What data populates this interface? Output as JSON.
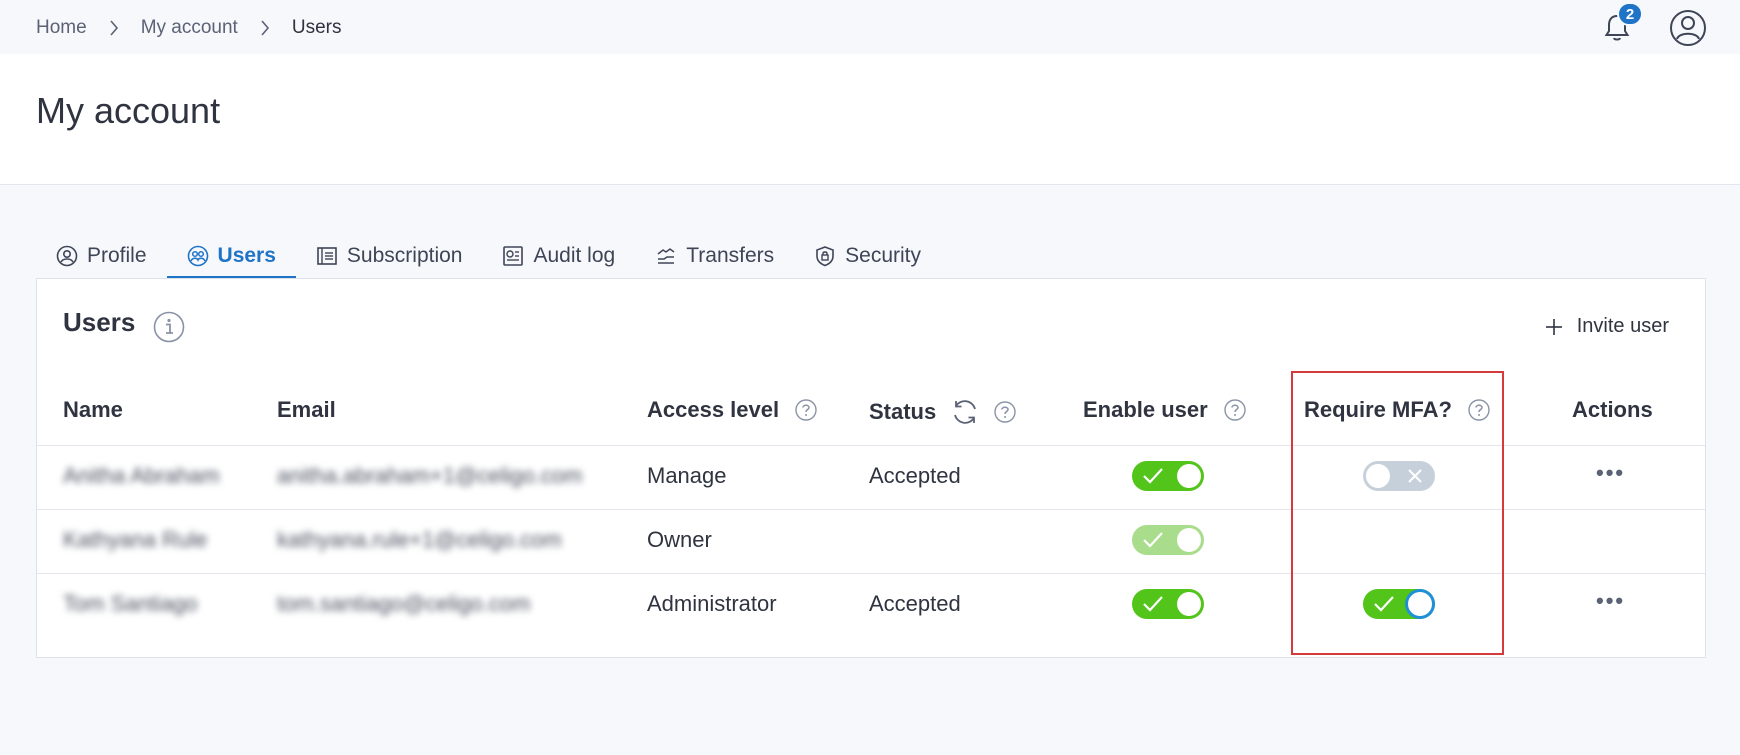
{
  "breadcrumb": {
    "home": "Home",
    "account": "My account",
    "current": "Users"
  },
  "notifications": {
    "count": "2"
  },
  "page": {
    "title": "My account"
  },
  "tabs": [
    {
      "label": "Profile",
      "icon": "user-circle-icon"
    },
    {
      "label": "Users",
      "icon": "users-icon"
    },
    {
      "label": "Subscription",
      "icon": "document-list-icon"
    },
    {
      "label": "Audit log",
      "icon": "audit-icon"
    },
    {
      "label": "Transfers",
      "icon": "transfer-icon"
    },
    {
      "label": "Security",
      "icon": "shield-lock-icon"
    }
  ],
  "panel": {
    "title": "Users",
    "invite_label": "Invite user"
  },
  "table": {
    "headers": {
      "name": "Name",
      "email": "Email",
      "access": "Access level",
      "status": "Status",
      "enable": "Enable user",
      "mfa": "Require MFA?",
      "actions": "Actions"
    },
    "rows": [
      {
        "name": "Anitha Abraham",
        "email": "anitha.abraham+1@celigo.com",
        "access": "Manage",
        "status": "Accepted",
        "enabled": true,
        "mfa": false,
        "actions": "..."
      },
      {
        "name": "Kathyana Rule",
        "email": "kathyana.rule+1@celigo.com",
        "access": "Owner",
        "status": "",
        "enabled": true,
        "mfa": null,
        "actions": ""
      },
      {
        "name": "Tom Santiago",
        "email": "tom.santiago@celigo.com",
        "access": "Administrator",
        "status": "Accepted",
        "enabled": true,
        "mfa": true,
        "actions": "..."
      }
    ]
  },
  "colors": {
    "accent": "#1f74c8",
    "toggle_on": "#52c41a",
    "toggle_off": "#c6d0db",
    "highlight": "#d63b3b"
  }
}
